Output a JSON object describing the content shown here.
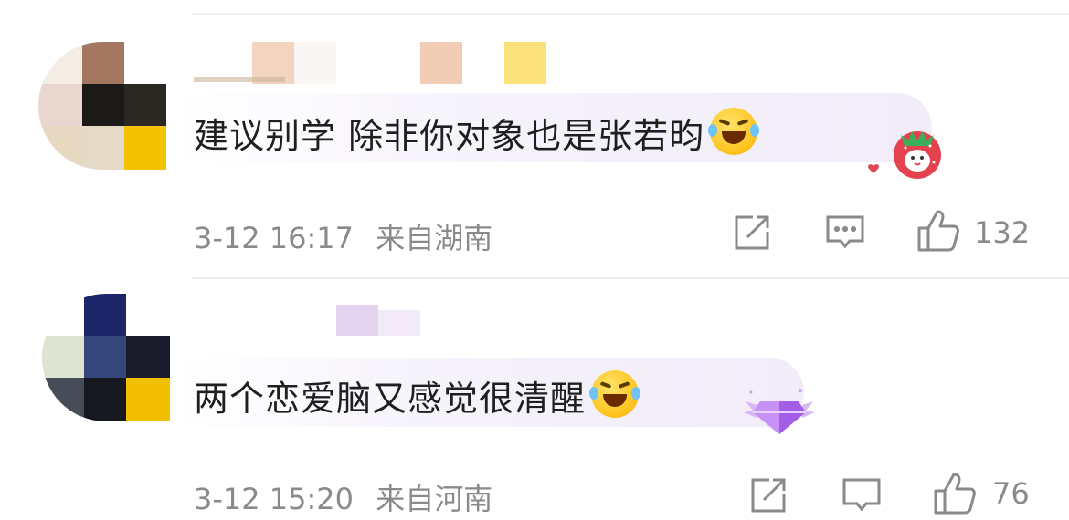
{
  "comments": [
    {
      "text": "建议别学 除非你对象也是张若昀",
      "emoji": "crying-laughing-emoji",
      "timestamp": "3-12 16:17",
      "location": "来自湖南",
      "likes": "132",
      "badge": "strawberry-badge"
    },
    {
      "text": "两个恋爱脑又感觉很清醒",
      "emoji": "tears-of-joy-emoji",
      "timestamp": "3-12 15:20",
      "location": "来自河南",
      "likes": "76",
      "badge": "purple-gem-badge"
    }
  ],
  "icons": {
    "share": "share-icon",
    "reply": "comment-icon",
    "like": "thumbs-up-icon"
  },
  "colors": {
    "text": "#1f1f1f",
    "meta": "#8a8a8a",
    "bubble": "#f1ecf8",
    "divider": "#eeeeee"
  }
}
